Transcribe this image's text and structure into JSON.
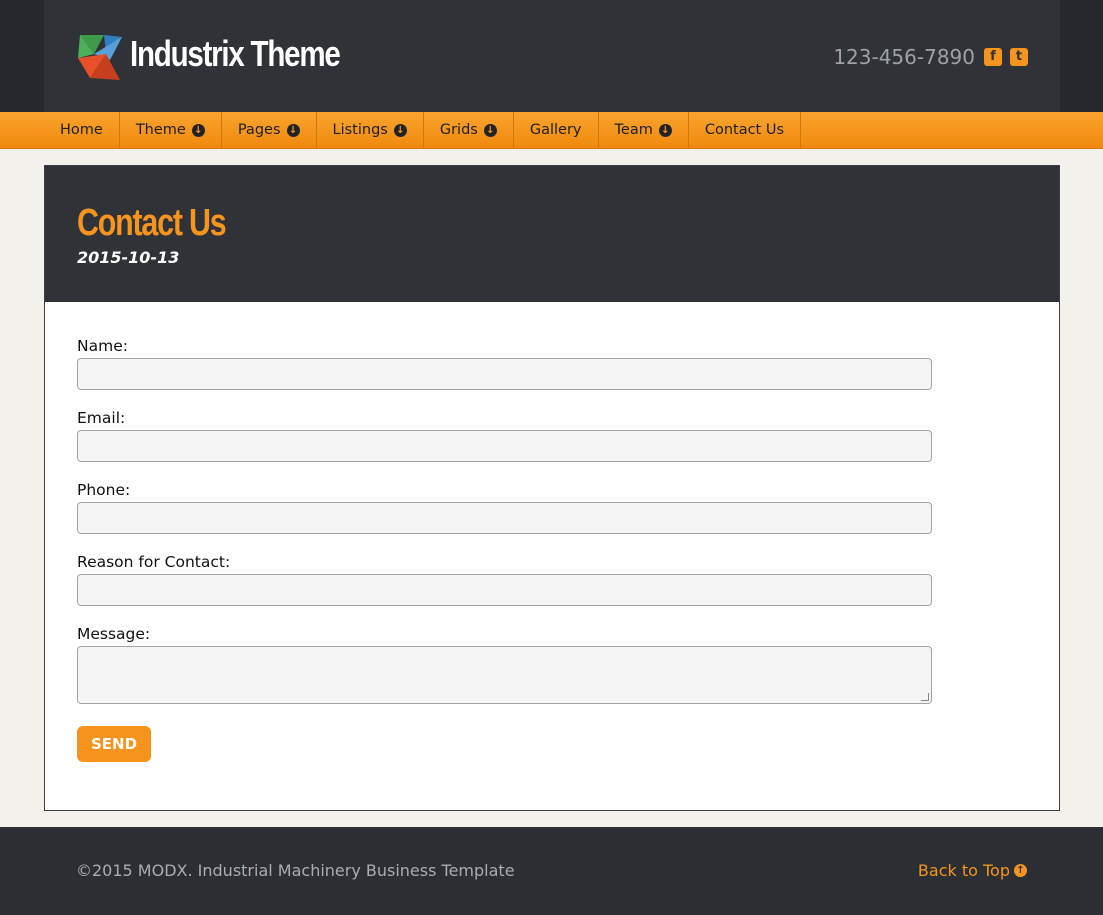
{
  "header": {
    "site_title": "Industrix Theme",
    "phone": "123-456-7890",
    "social_icons": [
      "facebook-square-icon",
      "twitter-square-icon"
    ]
  },
  "nav": {
    "items": [
      {
        "label": "Home",
        "dropdown": false
      },
      {
        "label": "Theme",
        "dropdown": true
      },
      {
        "label": "Pages",
        "dropdown": true
      },
      {
        "label": "Listings",
        "dropdown": true
      },
      {
        "label": "Grids",
        "dropdown": true
      },
      {
        "label": "Gallery",
        "dropdown": false
      },
      {
        "label": "Team",
        "dropdown": true
      },
      {
        "label": "Contact Us",
        "dropdown": false
      }
    ]
  },
  "page": {
    "title": "Contact Us",
    "date": "2015-10-13"
  },
  "form": {
    "name_label": "Name:",
    "email_label": "Email:",
    "phone_label": "Phone:",
    "reason_label": "Reason for Contact:",
    "message_label": "Message:",
    "name_value": "",
    "email_value": "",
    "phone_value": "",
    "reason_value": "",
    "message_value": "",
    "send_label": "SEND"
  },
  "footer": {
    "copyright": "©2015 MODX. Industrial Machinery Business Template",
    "back_to_top": "Back to Top"
  },
  "colors": {
    "accent": "#f7941d",
    "dark": "#2f3338",
    "page_bg": "#f4f1ec"
  }
}
